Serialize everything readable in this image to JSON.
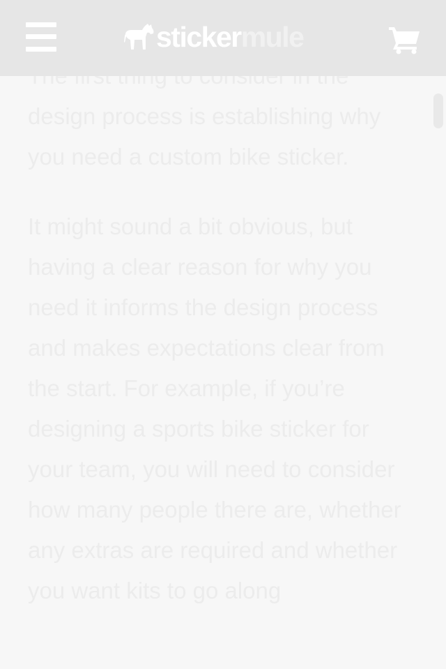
{
  "header": {
    "brand_part1": "sticker",
    "brand_part2": "mule",
    "menu_icon": "hamburger-menu-icon",
    "cart_icon": "shopping-cart-icon",
    "logo_icon": "mule-logo-icon"
  },
  "article": {
    "paragraphs": [
      "The first thing to consider in the design process is establishing why you need a custom bike sticker.",
      "It might sound a bit obvious, but having a clear reason for why you need it informs the design process and makes expectations clear from the start. For example, if you’re designing a sports bike sticker for your team, you will need to consider how many people there are, whether any extras are required and whether you want kits to go along"
    ]
  },
  "colors": {
    "header_bg": "#e6e6e6",
    "page_bg": "#f7f7f7",
    "text": "#ececec",
    "icon": "#ffffff"
  }
}
